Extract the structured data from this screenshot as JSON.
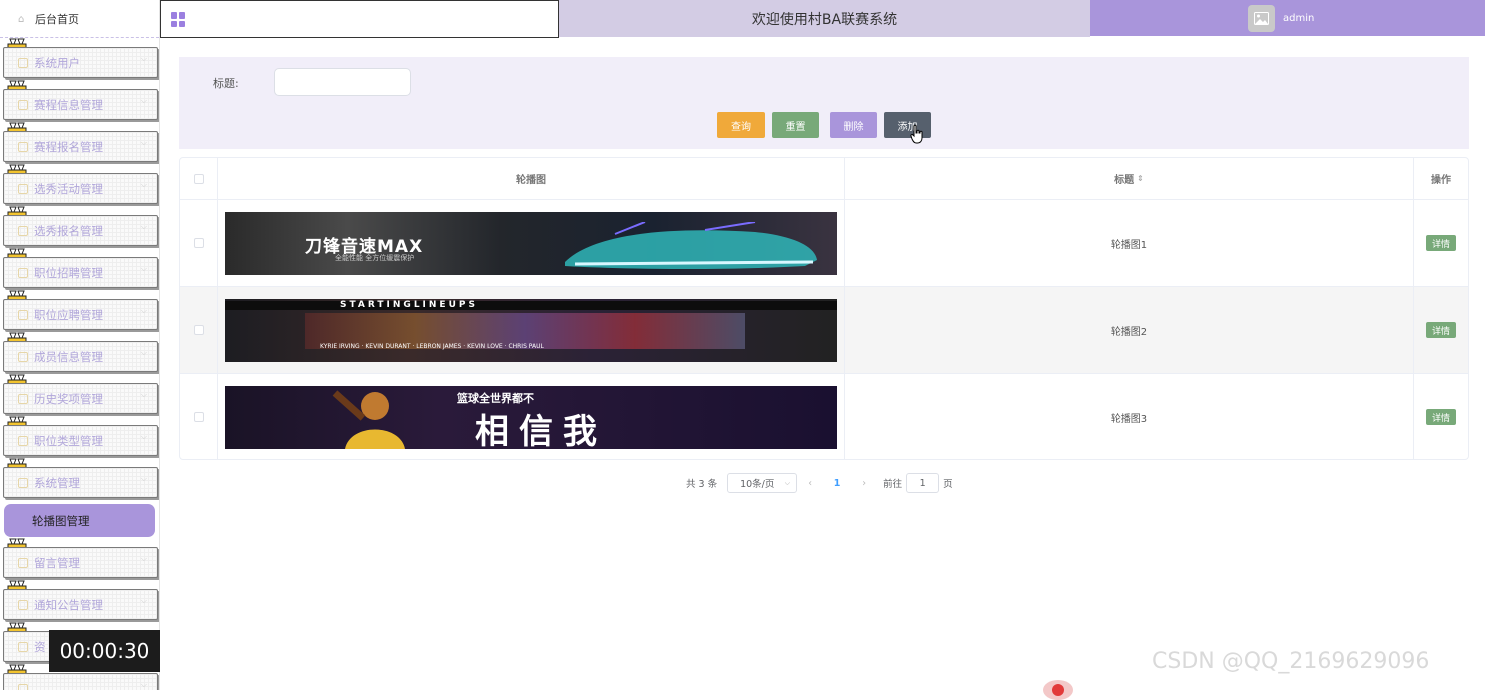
{
  "sidebar": {
    "home_label": "后台首页",
    "items": [
      {
        "label": "系统用户"
      },
      {
        "label": "赛程信息管理"
      },
      {
        "label": "赛程报名管理"
      },
      {
        "label": "选秀活动管理"
      },
      {
        "label": "选秀报名管理"
      },
      {
        "label": "职位招聘管理"
      },
      {
        "label": "职位应聘管理"
      },
      {
        "label": "成员信息管理"
      },
      {
        "label": "历史奖项管理"
      },
      {
        "label": "职位类型管理"
      },
      {
        "label": "系统管理"
      }
    ],
    "active_item": "轮播图管理",
    "items_after": [
      {
        "label": "留言管理"
      },
      {
        "label": "通知公告管理"
      },
      {
        "label": "资"
      },
      {
        "label": "...."
      }
    ]
  },
  "header": {
    "title": "欢迎使用村BA联赛系统",
    "username": "admin"
  },
  "search": {
    "title_label": "标题:",
    "title_value": "",
    "buttons": {
      "query": "查询",
      "reset": "重置",
      "delete": "删除",
      "add": "添加"
    }
  },
  "table": {
    "columns": {
      "image": "轮播图",
      "title": "标题",
      "ops": "操作"
    },
    "rows": [
      {
        "title": "轮播图1",
        "detail": "详情",
        "banner_text": "刀锋音速MAX",
        "banner_sub": "全能性能  全方位缓震保护"
      },
      {
        "title": "轮播图2",
        "detail": "详情",
        "banner_text": "STARTINGLINEUPS",
        "banner_sub": "KYRIE IRVING · KEVIN DURANT · LEBRON JAMES · KEVIN LOVE · CHRIS PAUL"
      },
      {
        "title": "轮播图3",
        "detail": "详情",
        "banner_text": "相信我",
        "banner_sub": "篮球全世界都不"
      }
    ]
  },
  "pagination": {
    "total": "共 3 条",
    "page_size": "10条/页",
    "current": "1",
    "goto_prefix": "前往",
    "goto_value": "1",
    "goto_suffix": "页"
  },
  "overlay": {
    "timer": "00:00:30",
    "watermark": "CSDN @QQ_2169629096"
  },
  "colors": {
    "accent": "#a995db",
    "header_mid": "#d3cce4",
    "query": "#f0a93a",
    "reset": "#78a979",
    "add": "#56606d"
  }
}
